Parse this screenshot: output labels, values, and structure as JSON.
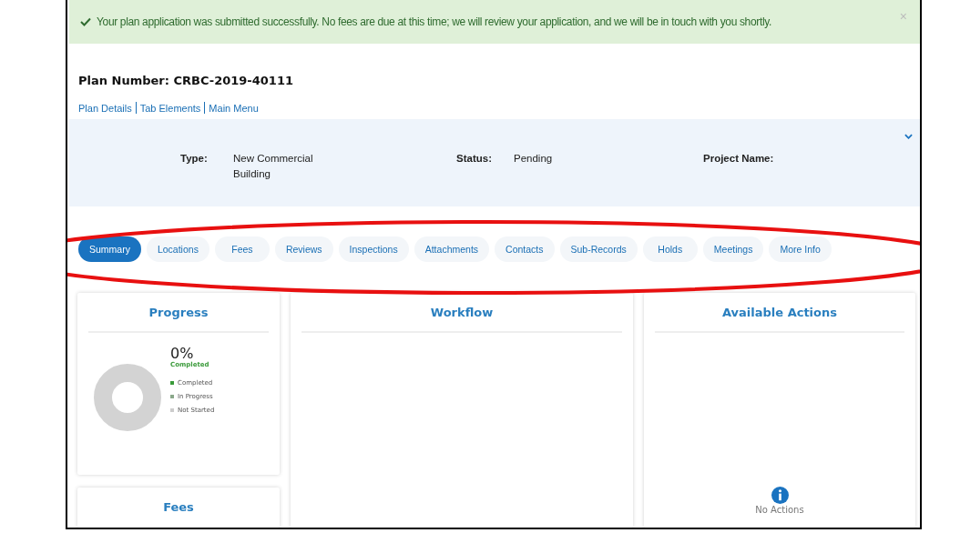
{
  "alert": {
    "message": "Your plan application was submitted successfully. No fees are due at this time; we will review your application, and we will be in touch with you shortly.",
    "close": "×"
  },
  "plan_number": "Plan Number: CRBC-2019-40111",
  "links": [
    "Plan Details",
    "Tab Elements",
    "Main Menu"
  ],
  "details": {
    "type_label": "Type:",
    "type_value": "New Commercial Building",
    "status_label": "Status:",
    "status_value": "Pending",
    "project_label": "Project Name:",
    "expanded": false
  },
  "tabs": [
    {
      "label": "Summary",
      "selected": true
    },
    {
      "label": "Locations",
      "selected": false
    },
    {
      "label": "Fees",
      "selected": false
    },
    {
      "label": "Reviews",
      "selected": false
    },
    {
      "label": "Inspections",
      "selected": false
    },
    {
      "label": "Attachments",
      "selected": false
    },
    {
      "label": "Contacts",
      "selected": false
    },
    {
      "label": "Sub-Records",
      "selected": false
    },
    {
      "label": "Holds",
      "selected": false
    },
    {
      "label": "Meetings",
      "selected": false
    },
    {
      "label": "More Info",
      "selected": false
    }
  ],
  "progress": {
    "title": "Progress",
    "percent": "0%",
    "caption": "Completed",
    "legend": [
      {
        "label": "Completed",
        "color": "#3a9a3a"
      },
      {
        "label": "In Progress",
        "color": "#8aa88a"
      },
      {
        "label": "Not Started",
        "color": "#cccccc"
      }
    ]
  },
  "fees": {
    "title": "Fees"
  },
  "workflow": {
    "title": "Workflow"
  },
  "actions": {
    "title": "Available Actions",
    "empty": "No Actions"
  }
}
